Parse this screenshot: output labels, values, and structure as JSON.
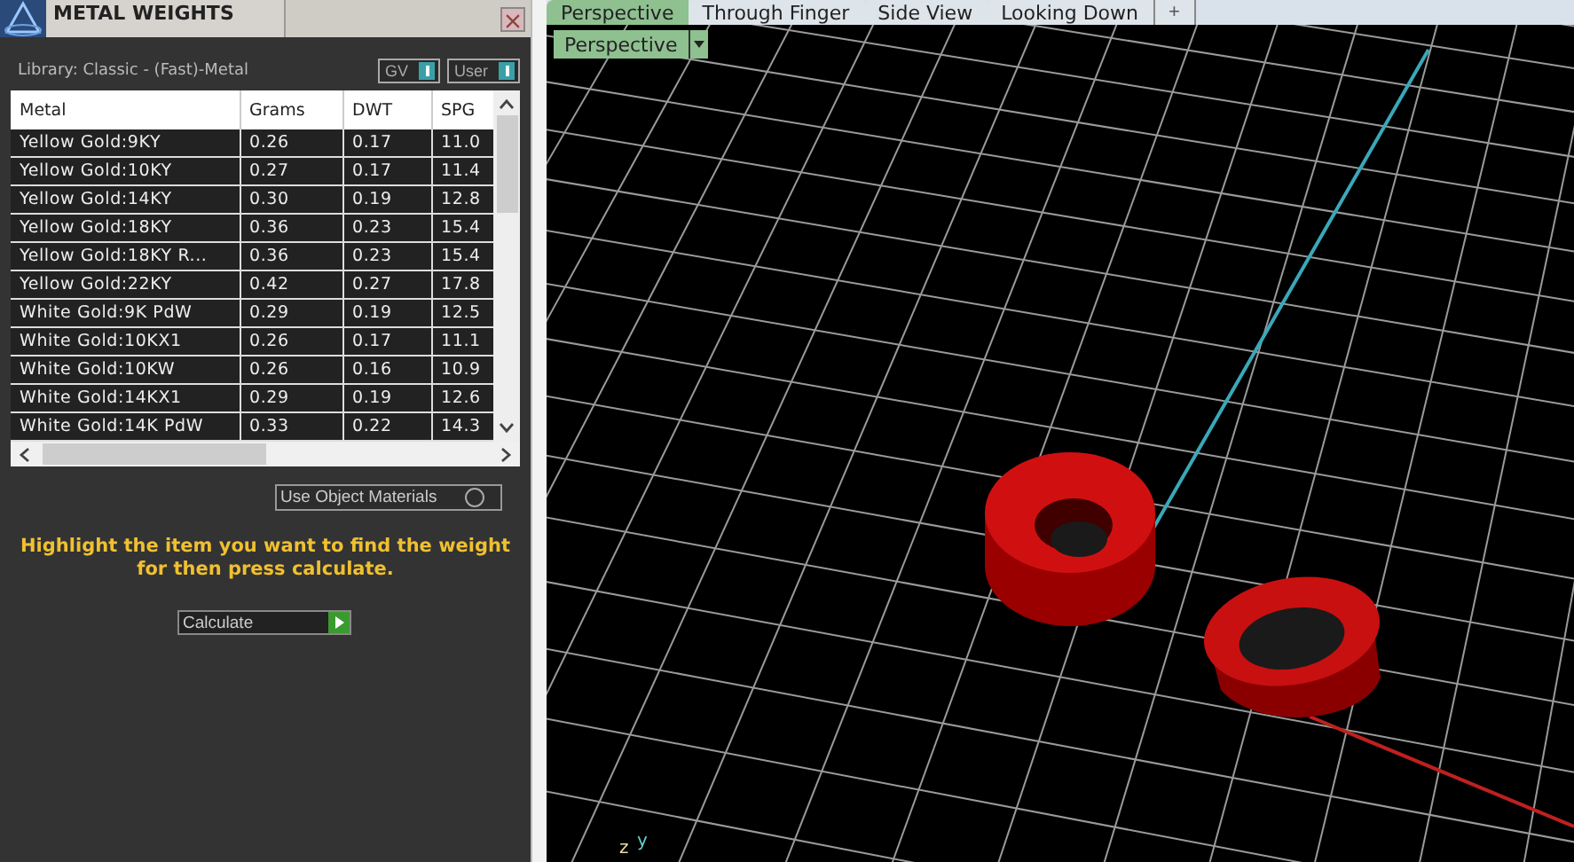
{
  "panel": {
    "title": "METAL WEIGHTS",
    "library": "Library: Classic - (Fast)-Metal",
    "toggles": [
      {
        "label": "GV",
        "on": true
      },
      {
        "label": "User",
        "on": true
      }
    ],
    "table": {
      "columns": [
        "Metal",
        "Grams",
        "DWT",
        "SPG"
      ],
      "rows": [
        {
          "metal": "Yellow Gold:9KY",
          "grams": "0.26",
          "dwt": "0.17",
          "spg": "11.0"
        },
        {
          "metal": "Yellow Gold:10KY",
          "grams": "0.27",
          "dwt": "0.17",
          "spg": "11.4"
        },
        {
          "metal": "Yellow Gold:14KY",
          "grams": "0.30",
          "dwt": "0.19",
          "spg": "12.8"
        },
        {
          "metal": "Yellow Gold:18KY",
          "grams": "0.36",
          "dwt": "0.23",
          "spg": "15.4"
        },
        {
          "metal": "Yellow Gold:18KY R...",
          "grams": "0.36",
          "dwt": "0.23",
          "spg": "15.4"
        },
        {
          "metal": "Yellow Gold:22KY",
          "grams": "0.42",
          "dwt": "0.27",
          "spg": "17.8"
        },
        {
          "metal": "White Gold:9K PdW",
          "grams": "0.29",
          "dwt": "0.19",
          "spg": "12.5"
        },
        {
          "metal": "White Gold:10KX1",
          "grams": "0.26",
          "dwt": "0.17",
          "spg": "11.1"
        },
        {
          "metal": "White Gold:10KW",
          "grams": "0.26",
          "dwt": "0.16",
          "spg": "10.9"
        },
        {
          "metal": "White Gold:14KX1",
          "grams": "0.29",
          "dwt": "0.19",
          "spg": "12.6"
        },
        {
          "metal": "White Gold:14K PdW",
          "grams": "0.33",
          "dwt": "0.22",
          "spg": "14.3"
        }
      ]
    },
    "use_object_materials": {
      "label": "Use Object Materials",
      "checked": false
    },
    "hint": "Highlight the item you want to find the weight for then press calculate.",
    "calculate": "Calculate"
  },
  "viewport": {
    "tabs": [
      {
        "label": "Perspective",
        "selected": true
      },
      {
        "label": "Through Finger",
        "selected": false
      },
      {
        "label": "Side View",
        "selected": false
      },
      {
        "label": "Looking Down",
        "selected": false
      }
    ],
    "add_tab": "+",
    "view_menu": "Perspective",
    "axis_labels": [
      "z",
      "y"
    ]
  }
}
